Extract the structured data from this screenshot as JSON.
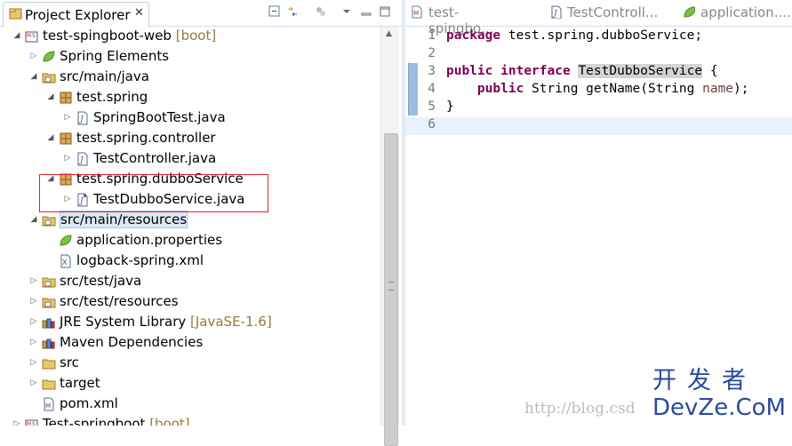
{
  "explorer": {
    "title": "Project Explorer",
    "close_glyph": "✕",
    "rows": [
      {
        "label": "test-spingboot-web",
        "decoration": " [boot]",
        "icon": "maven-project-icon",
        "twisty": "expanded"
      },
      {
        "label": "Spring Elements",
        "decoration": "",
        "icon": "spring-leaf-icon",
        "twisty": "collapsed"
      },
      {
        "label": "src/main/java",
        "decoration": "",
        "icon": "source-folder-icon",
        "twisty": "expanded"
      },
      {
        "label": "test.spring",
        "decoration": "",
        "icon": "package-icon",
        "twisty": "expanded"
      },
      {
        "label": "SpringBootTest.java",
        "decoration": "",
        "icon": "java-file-icon",
        "twisty": "collapsed"
      },
      {
        "label": "test.spring.controller",
        "decoration": "",
        "icon": "package-icon",
        "twisty": "expanded"
      },
      {
        "label": "TestController.java",
        "decoration": "",
        "icon": "java-file-icon",
        "twisty": "collapsed"
      },
      {
        "label": "test.spring.dubboService",
        "decoration": "",
        "icon": "package-icon",
        "twisty": "expanded"
      },
      {
        "label": "TestDubboService.java",
        "decoration": "",
        "icon": "java-interface-file-icon",
        "twisty": "collapsed"
      },
      {
        "label": "src/main/resources",
        "decoration": "",
        "icon": "source-folder-icon",
        "twisty": "expanded",
        "selected": true
      },
      {
        "label": "application.properties",
        "decoration": "",
        "icon": "spring-leaf-icon",
        "twisty": "none"
      },
      {
        "label": "logback-spring.xml",
        "decoration": "",
        "icon": "xml-file-icon",
        "twisty": "none"
      },
      {
        "label": "src/test/java",
        "decoration": "",
        "icon": "source-folder-icon",
        "twisty": "collapsed"
      },
      {
        "label": "src/test/resources",
        "decoration": "",
        "icon": "source-folder-icon",
        "twisty": "collapsed"
      },
      {
        "label": "JRE System Library",
        "decoration": " [JavaSE-1.6]",
        "icon": "library-icon",
        "twisty": "collapsed"
      },
      {
        "label": "Maven Dependencies",
        "decoration": "",
        "icon": "library-icon",
        "twisty": "collapsed"
      },
      {
        "label": "src",
        "decoration": "",
        "icon": "folder-icon",
        "twisty": "collapsed"
      },
      {
        "label": "target",
        "decoration": "",
        "icon": "folder-icon",
        "twisty": "collapsed"
      },
      {
        "label": "pom.xml",
        "decoration": "",
        "icon": "maven-file-icon",
        "twisty": "none"
      },
      {
        "label": "Test-springboot",
        "decoration": " [boot]",
        "icon": "maven-project-icon",
        "twisty": "collapsed"
      }
    ]
  },
  "editor": {
    "tabs": [
      {
        "label": "test-spingbo...",
        "icon": "doc-icon"
      },
      {
        "label": "TestControll...",
        "icon": "java-file-icon"
      },
      {
        "label": "application....",
        "icon": "spring-leaf-icon"
      }
    ],
    "lines": [
      {
        "n": "1",
        "parts": [
          {
            "t": "package",
            "c": "kw"
          },
          {
            "t": " test.spring.dubboService;",
            "c": ""
          }
        ]
      },
      {
        "n": "2",
        "parts": []
      },
      {
        "n": "3",
        "parts": [
          {
            "t": "public",
            "c": "kw"
          },
          {
            "t": " ",
            "c": ""
          },
          {
            "t": "interface",
            "c": "kw"
          },
          {
            "t": " ",
            "c": ""
          },
          {
            "t": "TestDubboService",
            "c": "hl"
          },
          {
            "t": " {",
            "c": ""
          }
        ]
      },
      {
        "n": "4",
        "parts": [
          {
            "t": "    ",
            "c": ""
          },
          {
            "t": "public",
            "c": "kw"
          },
          {
            "t": " String getName(String ",
            "c": ""
          },
          {
            "t": "name",
            "c": "param"
          },
          {
            "t": ");",
            "c": ""
          }
        ]
      },
      {
        "n": "5",
        "parts": [
          {
            "t": "}",
            "c": ""
          }
        ]
      },
      {
        "n": "6",
        "parts": [],
        "current": true
      }
    ]
  },
  "watermark": {
    "url": "http://blog.csd",
    "brand_cn": "开发者",
    "brand_en": "DevZe.CoM"
  },
  "colors": {
    "highlight_box": "#d9262b",
    "keyword": "#7f0055",
    "selection": "#dbe8f7"
  }
}
